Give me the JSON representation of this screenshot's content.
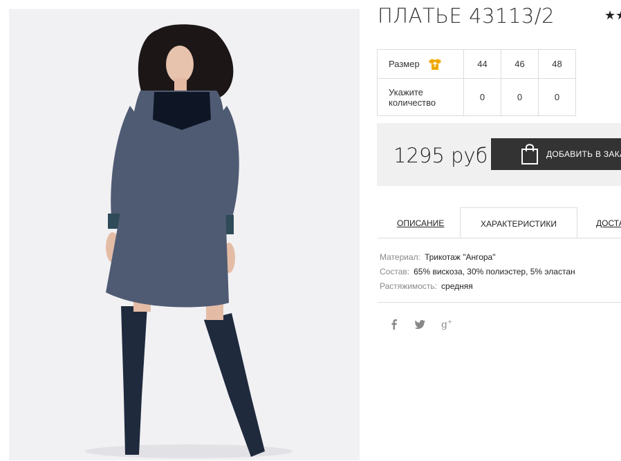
{
  "product": {
    "title": "ПЛАТЬЕ 43113/2",
    "rating_stars": "★★"
  },
  "size_table": {
    "size_label": "Размер",
    "size_icon": "tshirt-icon",
    "sizes": [
      "44",
      "46",
      "48"
    ],
    "quantity_label": "Укажите количество",
    "quantities": [
      "0",
      "0",
      "0"
    ]
  },
  "purchase": {
    "price": "1295 руб",
    "add_button_label": "ДОБАВИТЬ В ЗАКАЗ",
    "button_icon": "shopping-bag-icon"
  },
  "tabs": {
    "description": "ОПИСАНИЕ",
    "characteristics": "ХАРАКТЕРИСТИКИ",
    "delivery": "ДОСТАВКА",
    "active": "ХАРАКТЕРИСТИКИ"
  },
  "specs": [
    {
      "key": "Материал:",
      "value": "Трикотаж \"Ангора\""
    },
    {
      "key": "Состав:",
      "value": "65% вискоза, 30% полиэстер, 5% эластан"
    },
    {
      "key": "Растяжимость:",
      "value": "средняя"
    }
  ],
  "social": [
    "facebook-icon",
    "twitter-icon",
    "google-plus-icon"
  ],
  "colors": {
    "button_bg": "#333333",
    "buy_panel_bg": "#f0f0f0",
    "icon_accent": "#f0a800",
    "dress": "#4f5b73"
  }
}
